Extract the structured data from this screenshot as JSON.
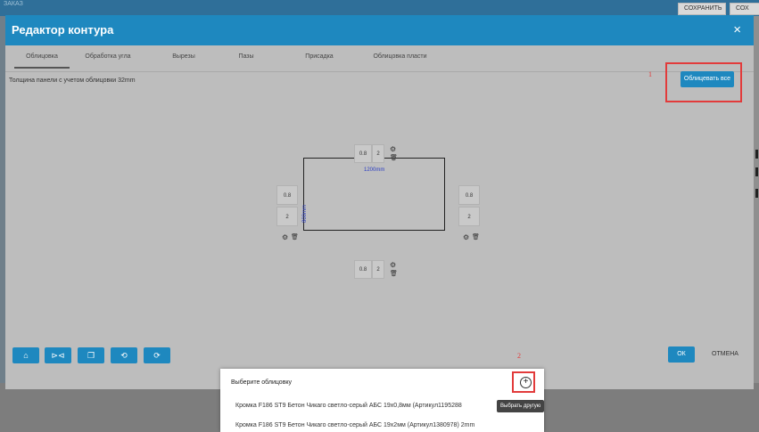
{
  "app": {
    "title": "ЗАКАЗ",
    "save_label": "СОХРАНИТЬ",
    "save2_label": "СОХ"
  },
  "modal": {
    "title": "Редактор контура",
    "close_glyph": "×"
  },
  "tabs": [
    {
      "label": "Облицовка",
      "active": true
    },
    {
      "label": "Обработка угла",
      "active": false
    },
    {
      "label": "Вырезы",
      "active": false
    },
    {
      "label": "Пазы",
      "active": false
    },
    {
      "label": "Присадка",
      "active": false
    },
    {
      "label": "Облицовка пласти",
      "active": false
    }
  ],
  "thickness_text": "Толщина панели с учетом облицовки 32mm",
  "face_all_label": "Облицевать все",
  "annotations": {
    "one": "1",
    "two": "2"
  },
  "drawing": {
    "width_label": "1200mm",
    "height_label": "800mm",
    "edges": {
      "top": {
        "thickness": "0.8",
        "layers": "2"
      },
      "bottom": {
        "thickness": "0.8",
        "layers": "2"
      },
      "left": {
        "thickness": "0.8",
        "layers": "2"
      },
      "right": {
        "thickness": "0.8",
        "layers": "2"
      }
    },
    "gear_glyph": "⚙",
    "trash_glyph": "🗑"
  },
  "toolbar": {
    "icons": [
      "attach-icon",
      "mirror-icon",
      "copy-icon",
      "rotate-left-icon",
      "rotate-right-icon"
    ],
    "glyphs": [
      "⌂",
      "⊳⊲",
      "❐",
      "⟲",
      "⟳"
    ],
    "ok_label": "ОК",
    "cancel_label": "ОТМЕНА"
  },
  "dropdown": {
    "title": "Выберите облицовку",
    "plus_glyph": "+",
    "items": [
      "Кромка F186 ST9 Бетон Чикаго светло-серый АБС 19x0,8мм (Артикул1195288",
      "Кромка F186 ST9 Бетон Чикаго светло-серый АБС 19x2мм (Артикул1380978) 2mm"
    ]
  },
  "tooltip": "Выбрать другую",
  "colors": {
    "accent": "#1e88bf",
    "highlight": "#e23b3b",
    "dimension": "#2c3ec2"
  }
}
